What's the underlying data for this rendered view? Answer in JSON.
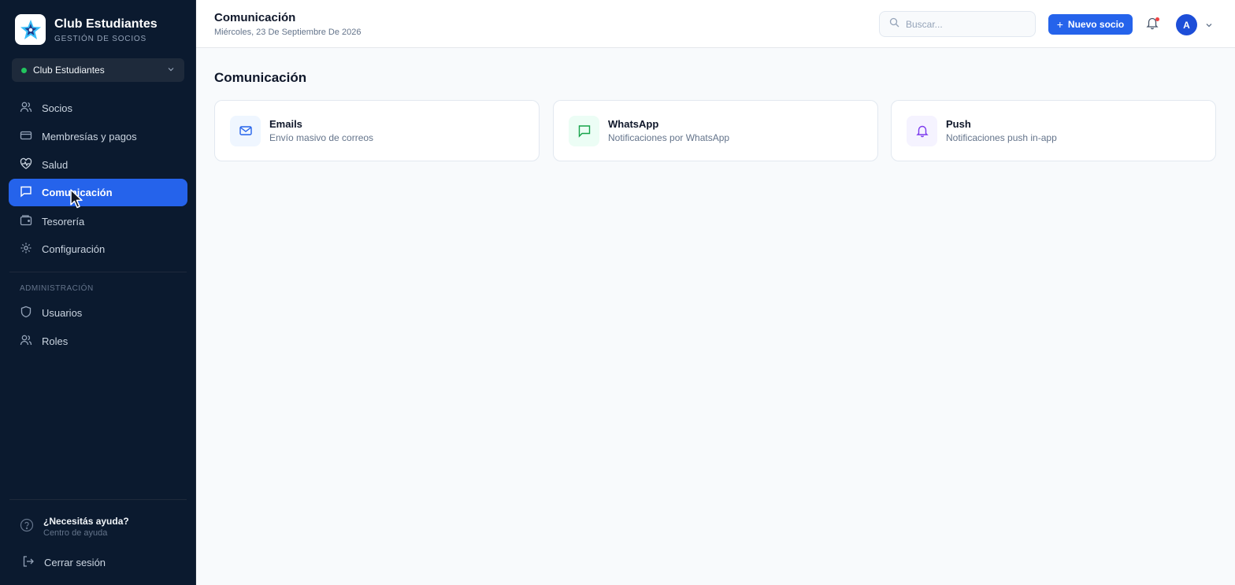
{
  "brand": {
    "name": "Club Estudiantes",
    "subtitle": "GESTIÓN DE SOCIOS"
  },
  "club_selector": {
    "value": "Club Estudiantes"
  },
  "nav": {
    "items": [
      {
        "label": "Socios",
        "icon": "users-icon"
      },
      {
        "label": "Membresías y pagos",
        "icon": "credit-card-icon"
      },
      {
        "label": "Salud",
        "icon": "heart-pulse-icon"
      },
      {
        "label": "Comunicación",
        "icon": "message-square-icon",
        "active": true
      },
      {
        "label": "Tesorería",
        "icon": "wallet-icon"
      },
      {
        "label": "Configuración",
        "icon": "gear-icon"
      }
    ],
    "admin_label": "ADMINISTRACIÓN",
    "admin_items": [
      {
        "label": "Usuarios",
        "icon": "shield-icon"
      },
      {
        "label": "Roles",
        "icon": "users-icon"
      }
    ]
  },
  "help": {
    "title": "¿Necesitás ayuda?",
    "subtitle": "Centro de ayuda"
  },
  "logout": {
    "label": "Cerrar sesión"
  },
  "header": {
    "title": "Comunicación",
    "date": "Miércoles, 23 De Septiembre De 2026",
    "search_placeholder": "Buscar...",
    "new_button": "Nuevo socio",
    "avatar_initial": "A"
  },
  "main": {
    "heading": "Comunicación",
    "cards": [
      {
        "title": "Emails",
        "subtitle": "Envío masivo de correos",
        "icon": "mail-icon"
      },
      {
        "title": "WhatsApp",
        "subtitle": "Notificaciones por WhatsApp",
        "icon": "message-icon"
      },
      {
        "title": "Push",
        "subtitle": "Notificaciones push in-app",
        "icon": "bell-icon"
      }
    ]
  },
  "colors": {
    "accent": "#2563eb",
    "sidebar_bg": "#0b1a2f",
    "status_green": "#22c55e",
    "notification_red": "#ef4444"
  }
}
